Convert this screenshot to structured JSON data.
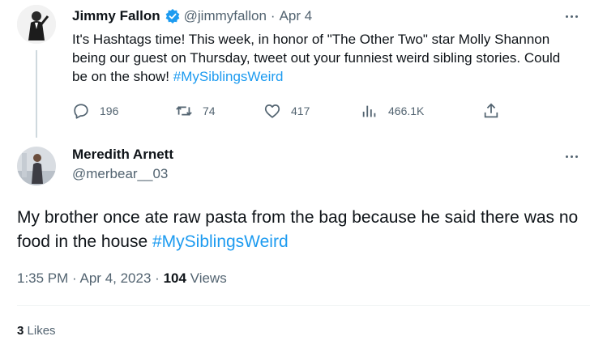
{
  "tweet1": {
    "name": "Jimmy Fallon",
    "handle": "@jimmyfallon",
    "separator": "·",
    "date": "Apr 4",
    "text_before": "It's Hashtags time! This week, in honor of \"The Other Two\" star Molly Shannon being our guest on Thursday, tweet out your funniest weird sibling stories. Could be on the show! ",
    "hashtag": "#MySiblingsWeird",
    "actions": {
      "replies": "196",
      "retweets": "74",
      "likes": "417",
      "views": "466.1K"
    }
  },
  "tweet2": {
    "name": "Meredith Arnett",
    "handle": "@merbear__03",
    "text_before": "My brother once ate raw pasta from the bag because he said there was no food in the house ",
    "hashtag": "#MySiblingsWeird",
    "time": "1:35 PM",
    "dot": "·",
    "date": "Apr 4, 2023",
    "views_count": "104",
    "views_label": "Views",
    "likes_count": "3",
    "likes_label": "Likes"
  },
  "colors": {
    "accent": "#1d9bf0",
    "muted": "#536471",
    "text": "#0f1419",
    "thread_line": "#cfd9de"
  },
  "icons": {
    "verified": "verified-badge-icon",
    "more": "more-options-icon",
    "reply": "reply-icon",
    "retweet": "retweet-icon",
    "like": "heart-icon",
    "views": "views-chart-icon",
    "share": "share-icon"
  }
}
